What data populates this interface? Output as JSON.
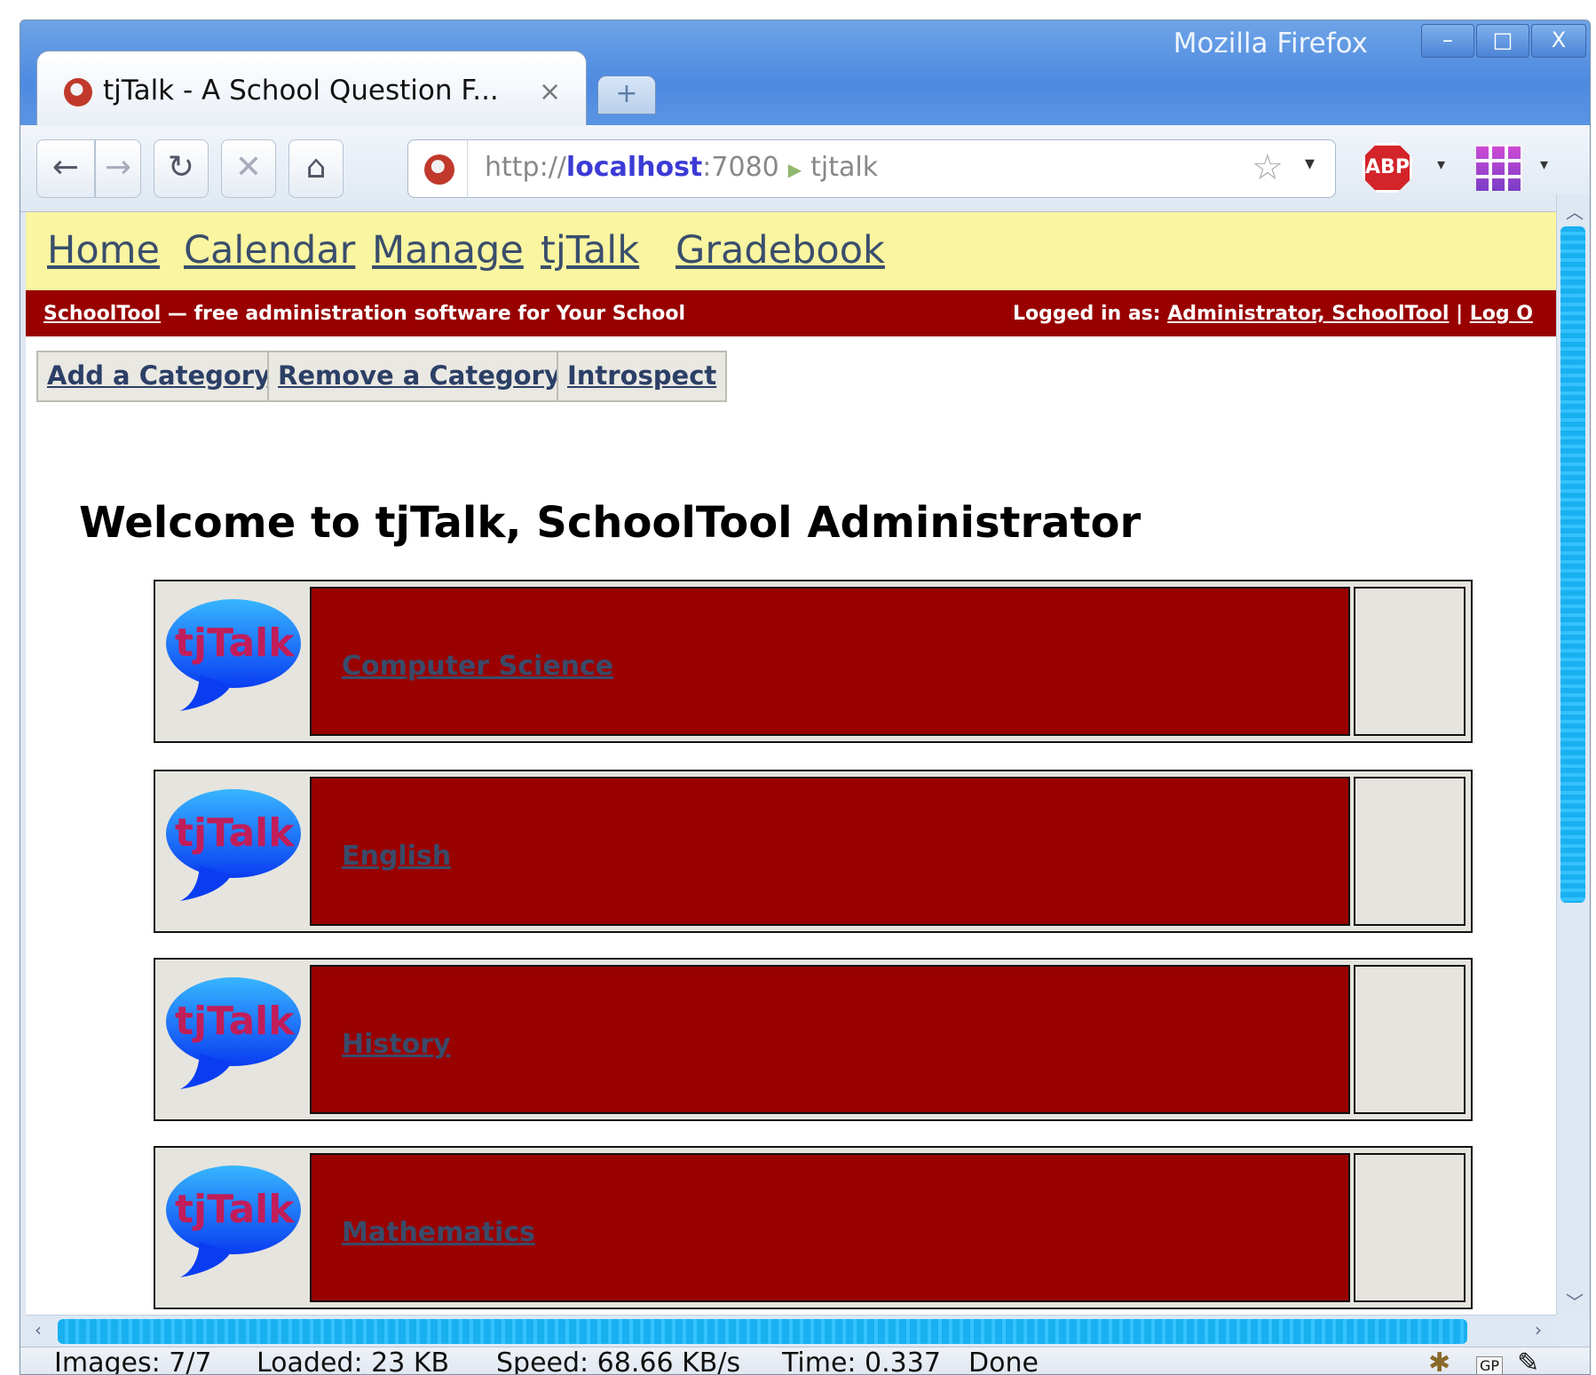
{
  "browser": {
    "window_title": "Mozilla Firefox",
    "tab_title": "tjTalk - A School Question F...",
    "url": {
      "scheme": "http://",
      "host": "localhost",
      "port": ":7080",
      "path": "tjtalk"
    },
    "controls": {
      "minimize": "–",
      "maximize": "□",
      "close": "X"
    },
    "toolbar_icons": [
      "back-icon",
      "forward-icon",
      "reload-icon",
      "stop-icon",
      "home-icon"
    ],
    "adblock_label": "ABP"
  },
  "nav": {
    "links": [
      "Home",
      "Calendar",
      "Manage",
      "tjTalk",
      "Gradebook"
    ]
  },
  "banner": {
    "brand": "SchoolTool",
    "tagline": " — free administration software for Your School",
    "logged_in_label": "Logged in as: ",
    "user": "Administrator, SchoolTool",
    "separator": " | ",
    "logout": "Log O"
  },
  "actions": [
    "Add a Category",
    "Remove a Category",
    "Introspect"
  ],
  "page": {
    "heading": "Welcome to tjTalk, SchoolTool Administrator"
  },
  "categories": [
    {
      "logo_text": "tjTalk",
      "name": "Computer Science"
    },
    {
      "logo_text": "tjTalk",
      "name": "English"
    },
    {
      "logo_text": "tjTalk",
      "name": "History"
    },
    {
      "logo_text": "tjTalk",
      "name": "Mathematics"
    }
  ],
  "status": {
    "images": "Images: 7/7",
    "loaded": "Loaded: 23 KB",
    "speed": "Speed: 68.66 KB/s",
    "time": "Time: 0.337",
    "state": "Done",
    "gp": "GP"
  },
  "colors": {
    "nav_bg": "#faf5a0",
    "banner_bg": "#990000",
    "accent_link": "#3a4e6c"
  }
}
